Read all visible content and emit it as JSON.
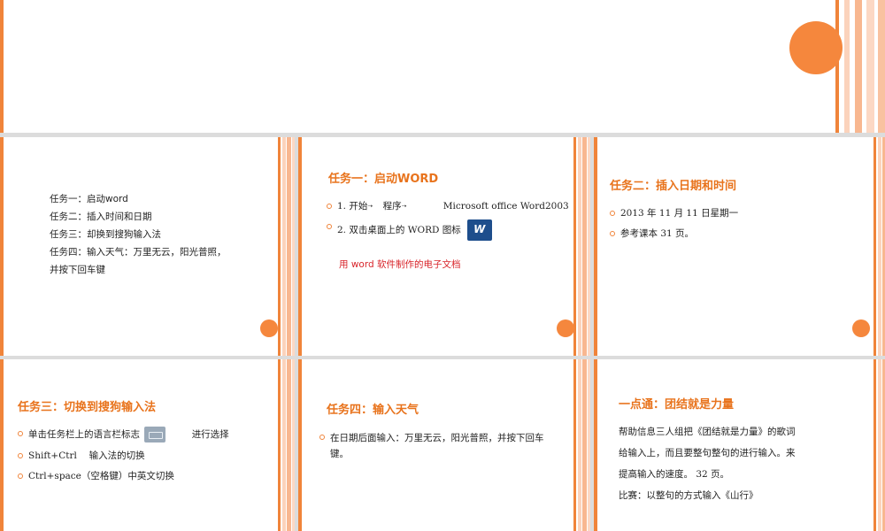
{
  "slide2": {
    "lines": [
      "任务一：启动word",
      "任务二：插入时间和日期",
      "任务三：却换到搜狗输入法",
      "任务四：输入天气：万里无云，阳光普照，",
      "并按下回车键"
    ]
  },
  "slide3": {
    "title": "任务一：启动WORD",
    "bullet1_a": "1. 开始",
    "bullet1_b": "程序",
    "bullet1_c": "Microsoft office Word2003",
    "bullet2": "2. 双击桌面上的 WORD 图标",
    "note": "用 word 软件制作的电子文档",
    "icon": "word-icon"
  },
  "slide4": {
    "title": "任务二：插入日期和时间",
    "bullets": [
      "2013 年 11 月 11 日星期一",
      "参考课本 31 页。"
    ]
  },
  "slide5": {
    "title": "任务三：切换到搜狗输入法",
    "bullet1_a": "单击任务栏上的语言栏标志",
    "bullet1_b": "进行选择",
    "bullet2": "Shift+Ctrl　 输入法的切换",
    "bullet3": "Ctrl+space（空格键）中英文切换",
    "icon": "keyboard-icon"
  },
  "slide6": {
    "title": "任务四：输入天气",
    "bullet1_a": "在日期后面输入：万里无云，阳光普照，并按下回车",
    "bullet1_b": "键。"
  },
  "slide7": {
    "title": "一点通：团结就是力量",
    "lines": [
      "帮助信息三人组把《团结就是力量》的歌词",
      "给输入上，而且要整句整句的进行输入。来",
      "提高输入的速度。 32 页。",
      "比赛：以整句的方式输入《山行》"
    ]
  },
  "colors": {
    "accent": "#f0843a",
    "title": "#e8731c",
    "note": "#d8242a"
  }
}
